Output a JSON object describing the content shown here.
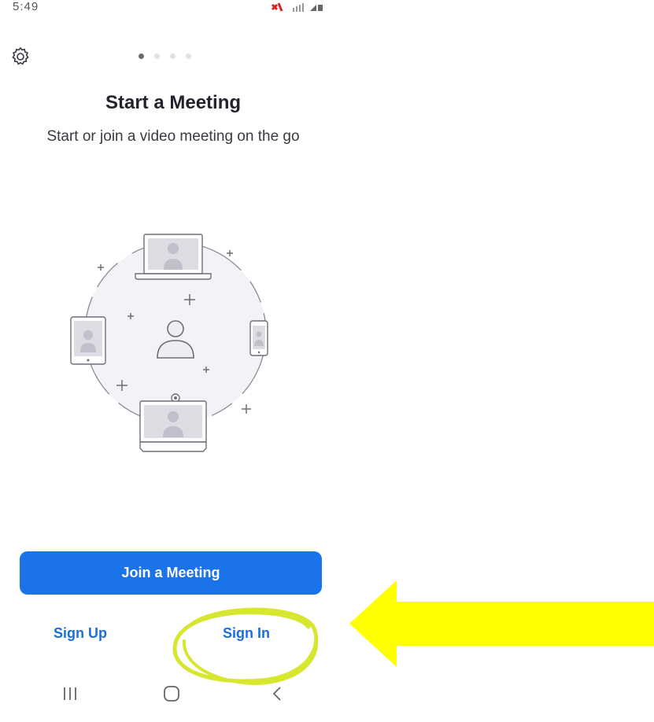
{
  "status_bar": {
    "time": "5:49"
  },
  "header": {
    "settings_icon": "gear-icon",
    "pager": {
      "count": 4,
      "active": 0
    }
  },
  "main": {
    "title": "Start a Meeting",
    "subtitle": "Start or join a video meeting on the go",
    "illustration_icon": "video-meeting-devices-illustration"
  },
  "actions": {
    "join_label": "Join a Meeting",
    "signup_label": "Sign Up",
    "signin_label": "Sign In"
  },
  "nav_bar": {
    "recents_icon": "recents-icon",
    "home_icon": "home-icon",
    "back_icon": "back-icon"
  },
  "colors": {
    "primary": "#1a73e8",
    "link": "#1a6fdc",
    "annotation_highlight": "#d7e62f",
    "annotation_arrow": "#ffff00"
  }
}
